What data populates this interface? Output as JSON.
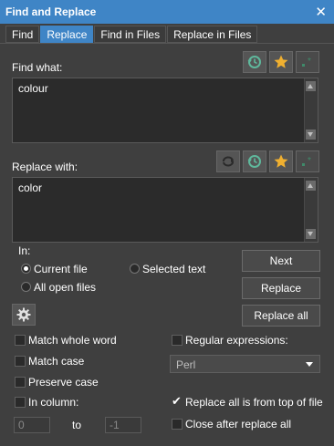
{
  "window": {
    "title": "Find and Replace"
  },
  "tabs": [
    {
      "label": "Find",
      "active": false
    },
    {
      "label": "Replace",
      "active": true
    },
    {
      "label": "Find in Files",
      "active": false
    },
    {
      "label": "Replace in Files",
      "active": false
    }
  ],
  "find": {
    "label": "Find what:",
    "value": "colour"
  },
  "replace": {
    "label": "Replace with:",
    "value": "color"
  },
  "toolbar_icons": {
    "find": [
      "history-icon",
      "favorites-star-icon",
      "regex-icon"
    ],
    "replace": [
      "swap-icon",
      "history-icon",
      "favorites-star-icon",
      "regex-icon"
    ],
    "accent_green": "#5fb89c",
    "accent_gold": "#f0b030"
  },
  "scope": {
    "label": "In:",
    "options": [
      {
        "label": "Current file",
        "selected": true
      },
      {
        "label": "Selected text",
        "selected": false
      },
      {
        "label": "All open files",
        "selected": false
      }
    ]
  },
  "buttons": {
    "next": "Next",
    "replace": "Replace",
    "replace_all": "Replace all"
  },
  "options": {
    "match_whole_word": {
      "label": "Match whole word",
      "checked": false
    },
    "match_case": {
      "label": "Match case",
      "checked": false
    },
    "preserve_case": {
      "label": "Preserve case",
      "checked": false
    },
    "in_column": {
      "label": "In column:",
      "checked": false
    },
    "regular_expressions": {
      "label": "Regular expressions:",
      "checked": false
    },
    "regex_engine": "Perl",
    "replace_all_from_top": {
      "label": "Replace all is from top of file",
      "checked": true
    },
    "close_after_replace_all": {
      "label": "Close after replace all",
      "checked": false
    }
  },
  "column_range": {
    "from": "0",
    "to_label": "to",
    "to": "-1"
  },
  "colors": {
    "accent": "#3f85c6",
    "background": "#3f3f3f",
    "field": "#2b2b2b"
  }
}
